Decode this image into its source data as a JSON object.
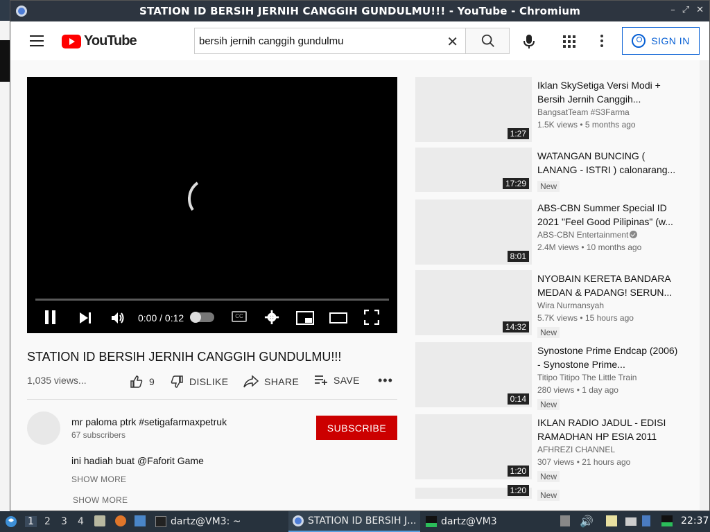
{
  "window": {
    "title": "STATION ID BERSIH JERNIH CANGGIH GUNDULMU!!! - YouTube - Chromium"
  },
  "header": {
    "logo_text": "YouTube",
    "search_value": "bersih jernih canggih gundulmu",
    "signin_label": "SIGN IN"
  },
  "player": {
    "time": "0:00 / 0:12",
    "progress_fraction": 0
  },
  "video": {
    "title": "STATION ID BERSIH JERNIH CANGGIH GUNDULMU!!!",
    "views": "1,035 views...",
    "likes": "9",
    "dislike_label": "DISLIKE",
    "share_label": "SHARE",
    "save_label": "SAVE"
  },
  "channel": {
    "name": "mr paloma ptrk #setigafarmaxpetruk",
    "subscribers": "67 subscribers",
    "subscribe_label": "SUBSCRIBE",
    "description": "ini hadiah buat @Faforit Game",
    "show_more": "SHOW MORE",
    "show_more_2": "SHOW MORE"
  },
  "recommendations": [
    {
      "title": "Iklan SkySetiga Versi Modi + Bersih Jernih Canggih...",
      "channel": "BangsatTeam #S3Farma",
      "meta": "1.5K views • 5 months ago",
      "duration": "1:27",
      "badge": ""
    },
    {
      "title": "WATANGAN BUNCING ( LANANG - ISTRI ) calonarang...",
      "channel": "",
      "meta": "",
      "duration": "17:29",
      "badge": "New"
    },
    {
      "title": "ABS-CBN Summer Special ID 2021 \"Feel Good Pilipinas\" (w...",
      "channel": "ABS-CBN Entertainment",
      "meta": "2.4M views • 10 months ago",
      "duration": "8:01",
      "badge": ""
    },
    {
      "title": "NYOBAIN KERETA BANDARA MEDAN & PADANG! SERUN...",
      "channel": "Wira Nurmansyah",
      "meta": "5.7K views • 15 hours ago",
      "duration": "14:32",
      "badge": "New"
    },
    {
      "title": "Synostone Prime Endcap (2006) - Synostone Prime...",
      "channel": "Titipo Titipo The Little Train",
      "meta": "280 views • 1 day ago",
      "duration": "0:14",
      "badge": "New"
    },
    {
      "title": "IKLAN RADIO JADUL - EDISI RAMADHAN HP ESIA 2011",
      "channel": "AFHREZI CHANNEL",
      "meta": "307 views • 21 hours ago",
      "duration": "1:20",
      "badge": "New"
    },
    {
      "title": "",
      "channel": "",
      "meta": "",
      "duration": "1:20",
      "badge": "New"
    }
  ],
  "taskbar": {
    "workspaces": [
      "1",
      "2",
      "3",
      "4"
    ],
    "tasks": [
      {
        "label": "dartz@VM3: ~"
      },
      {
        "label": "STATION ID BERSIH J..."
      },
      {
        "label": "dartz@VM3"
      }
    ],
    "clock": "22:37"
  }
}
